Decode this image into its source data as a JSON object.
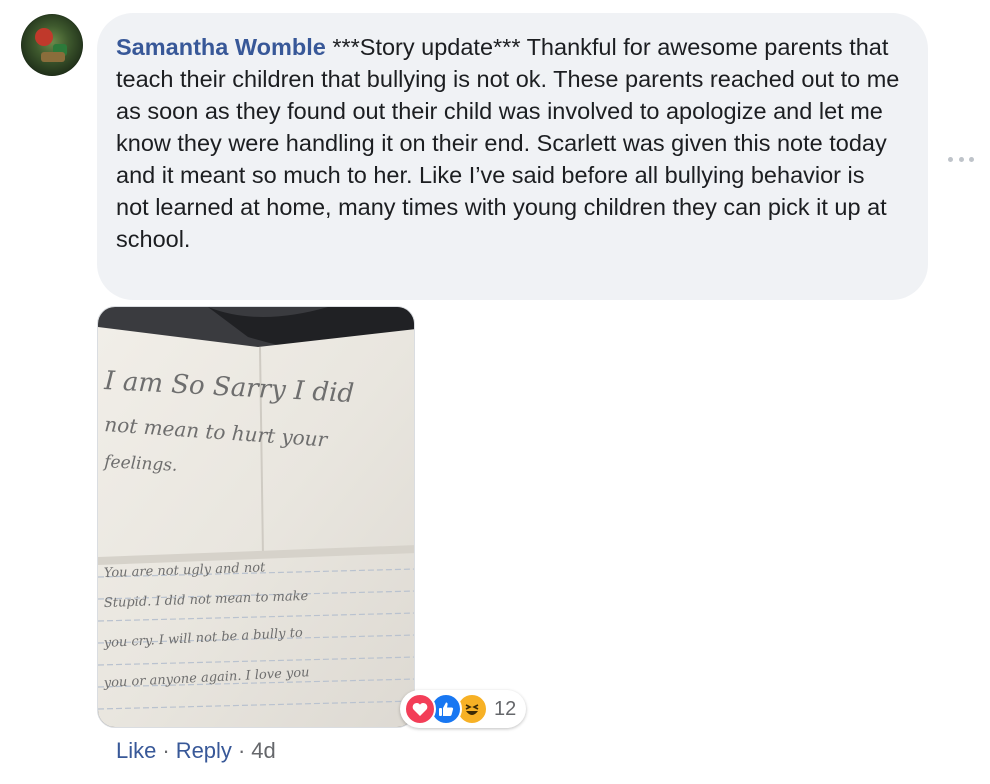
{
  "comment": {
    "author": "Samantha Womble",
    "text": "***Story update*** Thankful for awesome parents that teach their children that bullying is not ok. These parents reached out to me as soon as they found out their child was involved to apologize and let me know they were handling it on their end. Scarlett was given this note today and it meant so much to her. Like I’ve said before all bullying behavior is not learned at home, many times with young children they can pick it up at school."
  },
  "photo": {
    "note_lines": [
      "I am So Sarry I did",
      "not mean to hurt your",
      "feelings.",
      "You are not ugly and not",
      "Stupid. I did not mean to make",
      "you cry. I will not be a bully to",
      "you or anyone again. I love you"
    ]
  },
  "reactions": {
    "icons": [
      "love-icon",
      "like-icon",
      "haha-icon"
    ],
    "count": "12"
  },
  "actions": {
    "like": "Like",
    "reply": "Reply",
    "separator": "·",
    "time": "4d"
  },
  "colors": {
    "author": "#385898",
    "bubble_bg": "#f0f2f5",
    "meta": "#65676b",
    "love": "#f33e58",
    "like": "#1877f2",
    "haha": "#f7b125"
  }
}
